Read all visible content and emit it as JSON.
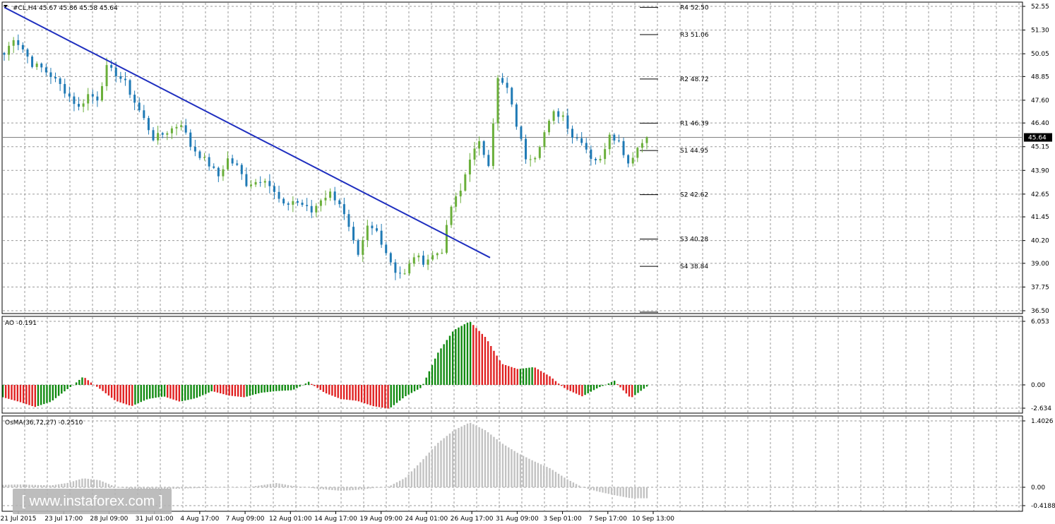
{
  "header": {
    "symbol_line": "#CL,H4  45.67 45.86 45.58 45.64"
  },
  "colors": {
    "bull": "#6aaf3a",
    "bear": "#1f7ab5",
    "trendline": "#1f2fbf",
    "ao_up": "#108a10",
    "ao_down": "#e02020",
    "osma": "#c2c2c2",
    "price_tag_bg": "#000000"
  },
  "current_price": {
    "value": 45.64,
    "label": "45.64"
  },
  "pivots": [
    {
      "label": "R4 52.50",
      "value": 52.5
    },
    {
      "label": "R3 51.06",
      "value": 51.06
    },
    {
      "label": "R2 48.72",
      "value": 48.72
    },
    {
      "label": "R1 46.39",
      "value": 46.39
    },
    {
      "label": "S1 44.95",
      "value": 44.95
    },
    {
      "label": "S2 42.62",
      "value": 42.62
    },
    {
      "label": "S3 40.28",
      "value": 40.28
    },
    {
      "label": "S4 38.84",
      "value": 38.84
    }
  ],
  "ao_panel": {
    "label": "AO -0.191",
    "ticks": [
      "6.053",
      "0.00",
      "-2.634"
    ]
  },
  "osma_panel": {
    "label": "OsMA(36,72,27) -0.2510",
    "ticks": [
      "1.4026",
      "0.00",
      "-0.4188"
    ]
  },
  "watermark": "[ www.instaforex.com ]",
  "chart_data": [
    {
      "type": "candlestick",
      "title": "#CL,H4",
      "ylim": [
        36.5,
        52.55
      ],
      "price_ticks": [
        "52.55",
        "51.30",
        "50.05",
        "48.85",
        "47.60",
        "46.40",
        "45.15",
        "43.90",
        "42.65",
        "41.45",
        "40.20",
        "39.00",
        "37.75",
        "36.50"
      ],
      "time_labels": [
        "21 Jul 2015",
        "23 Jul 17:00",
        "28 Jul 09:00",
        "31 Jul 01:00",
        "4 Aug 17:00",
        "7 Aug 09:00",
        "12 Aug 01:00",
        "14 Aug 17:00",
        "19 Aug 09:00",
        "24 Aug 01:00",
        "26 Aug 17:00",
        "31 Aug 09:00",
        "3 Sep 01:00",
        "7 Sep 17:00",
        "10 Sep 13:00"
      ],
      "close_path": [
        50.0,
        50.9,
        50.3,
        49.5,
        49.3,
        48.9,
        48.4,
        47.8,
        47.2,
        47.9,
        47.7,
        49.3,
        49.0,
        48.5,
        47.5,
        46.6,
        45.6,
        45.8,
        46.1,
        46.4,
        45.2,
        44.7,
        44.2,
        43.6,
        44.5,
        44.1,
        43.2,
        43.3,
        43.5,
        42.7,
        42.0,
        42.3,
        42.1,
        41.7,
        42.4,
        42.7,
        42.2,
        40.8,
        39.3,
        40.9,
        40.7,
        39.6,
        38.6,
        38.4,
        39.4,
        39.1,
        39.4,
        39.7,
        42.0,
        42.8,
        44.6,
        45.3,
        44.3,
        48.7,
        48.2,
        46.3,
        44.6,
        44.7,
        45.9,
        46.9,
        46.8,
        45.7,
        45.5,
        44.6,
        44.4,
        45.9,
        45.4,
        44.3,
        45.1,
        45.64
      ],
      "trendline": {
        "from": [
          "21 Jul 2015",
          52.5
        ],
        "to": [
          "27 Aug",
          39.3
        ]
      },
      "current_price": 45.64,
      "pivot_levels": [
        52.5,
        51.06,
        48.72,
        46.39,
        44.95,
        42.62,
        40.28,
        38.84
      ]
    },
    {
      "type": "bar",
      "title": "AO -0.191",
      "ylim": [
        -2.634,
        6.053
      ],
      "values": [
        -1.4,
        -1.9,
        -2.5,
        -1.9,
        -0.5,
        0.8,
        -0.4,
        -1.8,
        -2.4,
        -1.6,
        -1.3,
        -1.9,
        -1.5,
        -0.7,
        -1.2,
        -1.4,
        -0.9,
        -0.7,
        -0.6,
        0.3,
        -0.9,
        -1.6,
        -1.8,
        -2.4,
        -2.7,
        -1.3,
        -0.3,
        3.0,
        5.2,
        6.05,
        4.5,
        2.0,
        1.5,
        1.7,
        0.8,
        -0.5,
        -1.3,
        -0.3,
        0.4,
        -1.5,
        -0.191
      ]
    },
    {
      "type": "bar",
      "title": "OsMA(36,72,27) -0.2510",
      "ylim": [
        -0.4188,
        1.4026
      ],
      "values": [
        0.05,
        0.06,
        0.05,
        0.04,
        0.09,
        0.19,
        0.15,
        0.01,
        -0.04,
        -0.05,
        -0.04,
        -0.03,
        -0.02,
        -0.01,
        0.0,
        -0.01,
        0.04,
        0.09,
        0.03,
        -0.01,
        -0.05,
        -0.08,
        -0.06,
        -0.02,
        0.02,
        0.2,
        0.55,
        0.93,
        1.2,
        1.37,
        1.2,
        0.93,
        0.72,
        0.55,
        0.4,
        0.18,
        0.0,
        -0.1,
        -0.18,
        -0.25,
        -0.251
      ]
    }
  ]
}
